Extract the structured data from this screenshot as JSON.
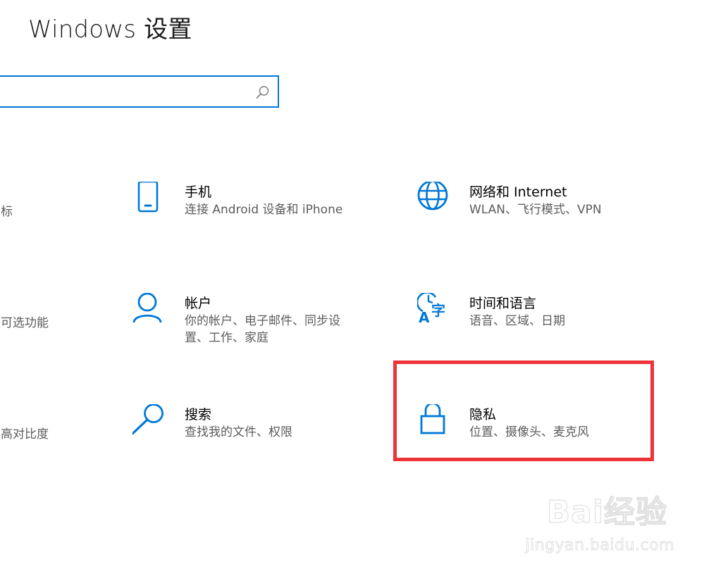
{
  "window": {
    "title": "Windows 设置"
  },
  "search": {
    "value": "",
    "placeholder": ""
  },
  "left_column_partial": [
    {
      "label": "标"
    },
    {
      "label": "可选功能"
    },
    {
      "label": "高对比度"
    }
  ],
  "tiles": [
    {
      "title": "手机",
      "desc": "连接 Android 设备和 iPhone",
      "icon": "phone-icon"
    },
    {
      "title": "网络和 Internet",
      "desc": "WLAN、飞行模式、VPN",
      "icon": "globe-icon"
    },
    {
      "title": "帐户",
      "desc": "你的帐户、电子邮件、同步设置、工作、家庭",
      "icon": "person-icon"
    },
    {
      "title": "时间和语言",
      "desc": "语音、区域、日期",
      "icon": "time-language-icon"
    },
    {
      "title": "搜索",
      "desc": "查找我的文件、权限",
      "icon": "search-icon"
    },
    {
      "title": "隐私",
      "desc": "位置、摄像头、麦克风",
      "icon": "lock-icon"
    }
  ],
  "highlight": {
    "target": "隐私",
    "color": "#ee3338"
  },
  "colors": {
    "accent": "#0078d7",
    "secondary_text": "#5c5c5c"
  },
  "watermark": {
    "brand": "Bai经验",
    "url": "jingyan.baidu.com"
  }
}
